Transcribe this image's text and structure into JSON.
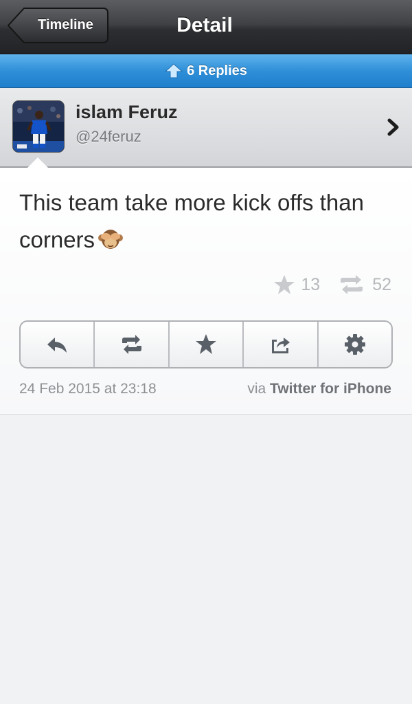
{
  "navbar": {
    "back_label": "Timeline",
    "title": "Detail"
  },
  "replies": {
    "label": "6 Replies",
    "icon": "up-arrow-icon"
  },
  "user": {
    "display_name": "islam Feruz",
    "handle": "@24feruz"
  },
  "tweet": {
    "text": "This team take more kick offs than corners",
    "emoji": "see-no-evil-monkey",
    "favorites_count": "13",
    "retweets_count": "52",
    "timestamp": "24 Feb 2015 at 23:18",
    "via_prefix": "via",
    "client": "Twitter for iPhone"
  },
  "actions": [
    {
      "icon": "reply-icon"
    },
    {
      "icon": "retweet-icon"
    },
    {
      "icon": "favorite-icon"
    },
    {
      "icon": "share-icon"
    },
    {
      "icon": "settings-icon"
    }
  ],
  "colors": {
    "navbar": "#3f4145",
    "replies_bar": "#2f8fd8",
    "muted_text": "#8e9094"
  }
}
